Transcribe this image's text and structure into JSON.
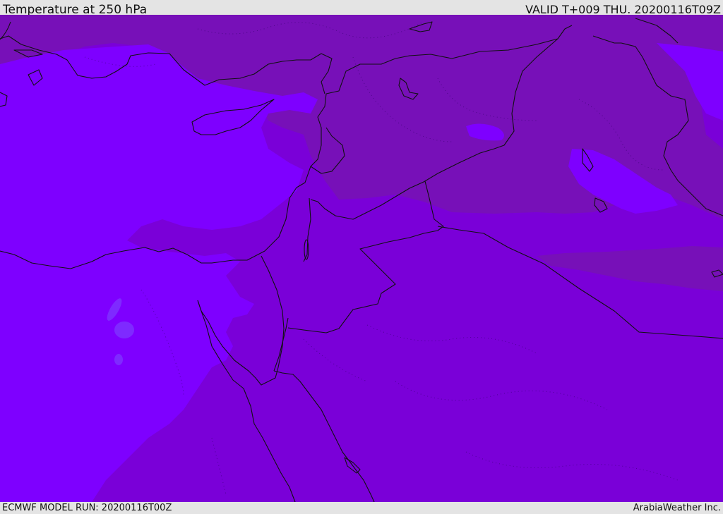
{
  "header": {
    "title": "Temperature at 250 hPa",
    "valid": "VALID T+009 THU. 20200116T09Z"
  },
  "footer": {
    "model_run": "ECMWF MODEL RUN: 20200116T00Z",
    "credit": "ArabiaWeather Inc."
  },
  "colors": {
    "background_field": "#7a00d8",
    "cold_band": "#7710b8",
    "warm_band": "#7e00ff",
    "warm_spot": "#7e2aff",
    "border_line": "#111111",
    "frame": "#e4e4e4"
  }
}
